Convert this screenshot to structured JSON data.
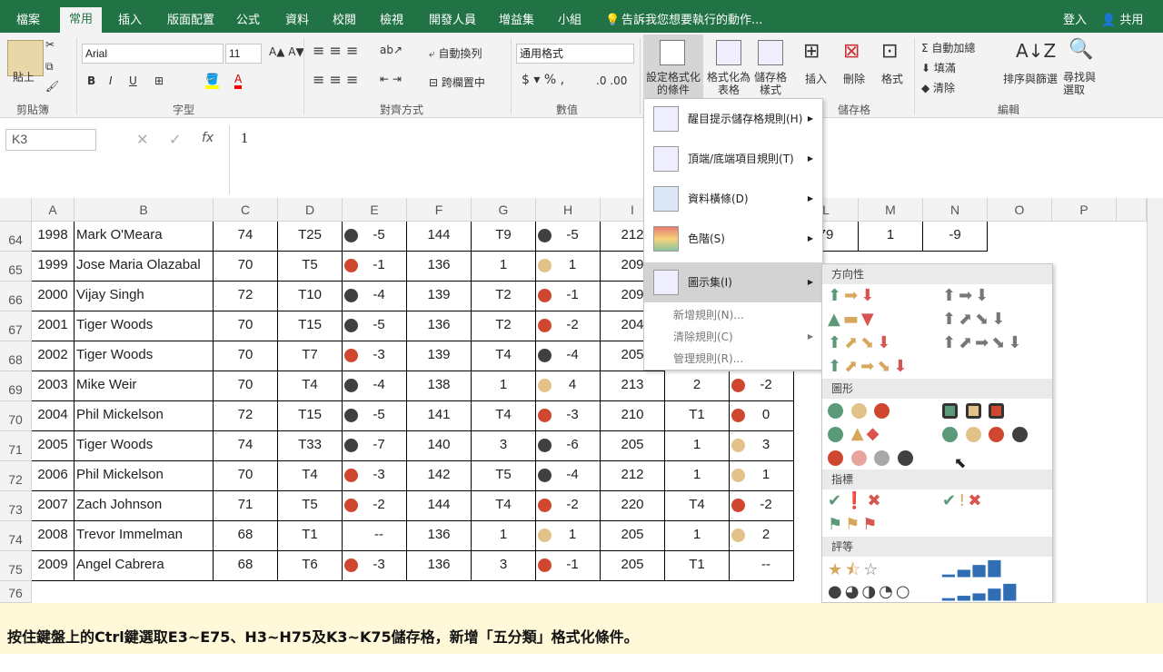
{
  "tabs": [
    "檔案",
    "常用",
    "插入",
    "版面配置",
    "公式",
    "資料",
    "校閱",
    "檢視",
    "開發人員",
    "增益集",
    "小組"
  ],
  "tell_me": "告訴我您想要執行的動作...",
  "signin": "登入",
  "share": "共用",
  "ribbon": {
    "paste": "貼上",
    "clipboard": "剪貼簿",
    "font": "Arial",
    "size": "11",
    "font_group": "字型",
    "align_group": "對齊方式",
    "wrap": "自動換列",
    "merge": "跨欄置中",
    "number_format": "通用格式",
    "number_group": "數值",
    "cond_format": "設定格式化的條件",
    "format_table": "格式化為表格",
    "cell_style": "儲存格樣式",
    "insert": "插入",
    "delete": "刪除",
    "format": "格式",
    "cells_group": "儲存格",
    "autosum": "自動加總",
    "fill": "填滿",
    "clear": "清除",
    "sort": "排序與篩選",
    "find": "尋找與選取",
    "edit_group": "編輯"
  },
  "formula_bar": {
    "name_box": "K3",
    "content": "1"
  },
  "columns": [
    "A",
    "B",
    "C",
    "D",
    "E",
    "F",
    "G",
    "H",
    "I",
    "L",
    "M",
    "N",
    "O",
    "P"
  ],
  "rows": [
    {
      "n": "64",
      "a": "1998",
      "b": "Mark O'Meara",
      "c": "74",
      "d": "T25",
      "ed": "dk",
      "e": "-5",
      "f": "144",
      "g": "T9",
      "hd": "dk",
      "h": "-5",
      "i": "212"
    },
    {
      "n": "65",
      "a": "1999",
      "b": "Jose Maria Olazabal",
      "c": "70",
      "d": "T5",
      "ed": "rd",
      "e": "-1",
      "f": "136",
      "g": "1",
      "hd": "yl",
      "h": "1",
      "i": "209"
    },
    {
      "n": "66",
      "a": "2000",
      "b": "Vijay Singh",
      "c": "72",
      "d": "T10",
      "ed": "dk",
      "e": "-4",
      "f": "139",
      "g": "T2",
      "hd": "rd",
      "h": "-1",
      "i": "209"
    },
    {
      "n": "67",
      "a": "2001",
      "b": "Tiger Woods",
      "c": "70",
      "d": "T15",
      "ed": "dk",
      "e": "-5",
      "f": "136",
      "g": "T2",
      "hd": "rd",
      "h": "-2",
      "i": "204"
    },
    {
      "n": "68",
      "a": "2002",
      "b": "Tiger Woods",
      "c": "70",
      "d": "T7",
      "ed": "rd",
      "e": "-3",
      "f": "139",
      "g": "T4",
      "hd": "dk",
      "h": "-4",
      "i": "205"
    },
    {
      "n": "69",
      "a": "2003",
      "b": "Mike Weir",
      "c": "70",
      "d": "T4",
      "ed": "dk",
      "e": "-4",
      "f": "138",
      "g": "1",
      "hd": "yl",
      "h": "4",
      "i": "213",
      "j": "2",
      "kd": "rd",
      "k": "-2"
    },
    {
      "n": "70",
      "a": "2004",
      "b": "Phil Mickelson",
      "c": "72",
      "d": "T15",
      "ed": "dk",
      "e": "-5",
      "f": "141",
      "g": "T4",
      "hd": "rd",
      "h": "-3",
      "i": "210",
      "j": "T1",
      "kd": "rd",
      "k": "0"
    },
    {
      "n": "71",
      "a": "2005",
      "b": "Tiger Woods",
      "c": "74",
      "d": "T33",
      "ed": "dk",
      "e": "-7",
      "f": "140",
      "g": "3",
      "hd": "dk",
      "h": "-6",
      "i": "205",
      "j": "1",
      "kd": "yl",
      "k": "3"
    },
    {
      "n": "72",
      "a": "2006",
      "b": "Phil Mickelson",
      "c": "70",
      "d": "T4",
      "ed": "rd",
      "e": "-3",
      "f": "142",
      "g": "T5",
      "hd": "dk",
      "h": "-4",
      "i": "212",
      "j": "1",
      "kd": "yl",
      "k": "1"
    },
    {
      "n": "73",
      "a": "2007",
      "b": "Zach Johnson",
      "c": "71",
      "d": "T5",
      "ed": "rd",
      "e": "-2",
      "f": "144",
      "g": "T4",
      "hd": "rd",
      "h": "-2",
      "i": "220",
      "j": "T4",
      "kd": "rd",
      "k": "-2"
    },
    {
      "n": "74",
      "a": "2008",
      "b": "Trevor Immelman",
      "c": "68",
      "d": "T1",
      "ed": "",
      "e": "--",
      "f": "136",
      "g": "1",
      "hd": "yl",
      "h": "1",
      "i": "205",
      "j": "1",
      "kd": "yl",
      "k": "2"
    },
    {
      "n": "75",
      "a": "2009",
      "b": "Angel Cabrera",
      "c": "68",
      "d": "T6",
      "ed": "rd",
      "e": "-3",
      "f": "136",
      "g": "3",
      "hd": "rd",
      "h": "-1",
      "i": "205",
      "j": "T1",
      "kd": "",
      "k": "--"
    }
  ],
  "row76": "76",
  "row64_extra": {
    "l": "79",
    "m": "1",
    "n": "-9"
  },
  "menu": {
    "items": [
      "醒目提示儲存格規則(H)",
      "頂端/底端項目規則(T)",
      "資料橫條(D)",
      "色階(S)",
      "圖示集(I)"
    ],
    "small": [
      "新增規則(N)...",
      "清除規則(C)",
      "管理規則(R)..."
    ]
  },
  "submenu": {
    "dir": "方向性",
    "shape": "圖形",
    "indicator": "指標",
    "rating": "評等"
  },
  "caption": "按住鍵盤上的Ctrl鍵選取E3~E75、H3~H75及K3~K75儲存格，新增「五分類」格式化條件。",
  "colors": {
    "green": "#217346",
    "dark": "#404040",
    "red": "#d0472f",
    "yellow": "#e3c28a"
  }
}
